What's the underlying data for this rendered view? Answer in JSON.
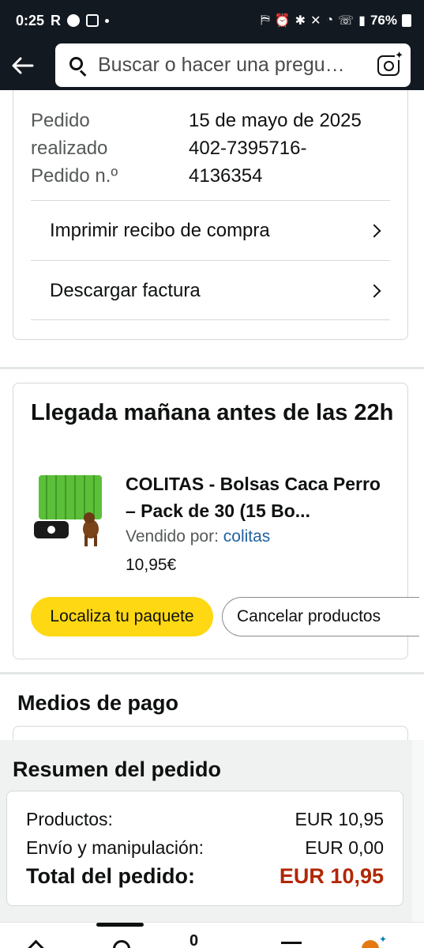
{
  "status_bar": {
    "time": "0:25",
    "carrier_letter": "R",
    "battery": "76%"
  },
  "nav": {
    "search_placeholder": "Buscar o hacer una pregu…",
    "icons": [
      "back-arrow-icon",
      "search-icon",
      "camera-lens-icon"
    ]
  },
  "order": {
    "labels": [
      "Pedido",
      "realizado",
      "Pedido n.º"
    ],
    "date": "15 de mayo de 2025",
    "number_line1": "402-7395716-",
    "number_line2": "4136354",
    "rows": [
      {
        "label": "Imprimir recibo de compra"
      },
      {
        "label": "Descargar factura"
      }
    ]
  },
  "delivery": {
    "title": "Llegada mañana antes de las 22h",
    "product_title": "COLITAS - Bolsas Caca Perro – Pack de 30 (15 Bo...",
    "sold_by_label": "Vendido por:",
    "seller": "colitas",
    "price": "10,95€",
    "track_button": "Localiza tu paquete",
    "cancel_button": "Cancelar productos"
  },
  "payment": {
    "title": "Medios de pago"
  },
  "summary": {
    "title": "Resumen del pedido",
    "rows": [
      {
        "label": "Productos:",
        "value": "EUR 10,95"
      },
      {
        "label": "Envío y manipulación:",
        "value": "EUR 0,00"
      }
    ],
    "total_label": "Total del pedido:",
    "total_value": "EUR 10,95",
    "total_color": "#b12704"
  },
  "bottom_nav": {
    "cart_count": "0",
    "icons": [
      "home-icon",
      "account-icon",
      "cart-icon",
      "menu-icon",
      "rufus-ai-icon"
    ]
  },
  "colors": {
    "header_bg": "#131921",
    "primary_button": "#ffd814",
    "link": "#2162a1"
  }
}
